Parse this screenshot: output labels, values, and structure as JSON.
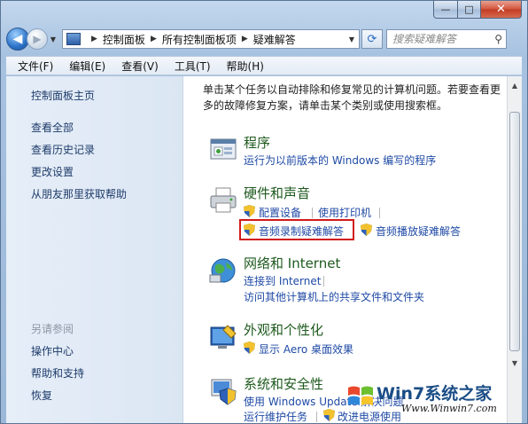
{
  "window": {
    "caption": {
      "minimize": "—",
      "maximize": "□",
      "close": "✕"
    }
  },
  "nav": {
    "back": "◀",
    "forward": "▶",
    "dropdown": "▼",
    "breadcrumbs": [
      "控制面板",
      "所有控制面板项",
      "疑难解答"
    ],
    "search_placeholder": "搜索疑难解答"
  },
  "menu": [
    "文件(F)",
    "编辑(E)",
    "查看(V)",
    "工具(T)",
    "帮助(H)"
  ],
  "left_pane": {
    "links": [
      "控制面板主页",
      "查看全部",
      "查看历史记录",
      "更改设置",
      "从朋友那里获取帮助"
    ],
    "see_also_title": "另请参阅",
    "see_also_links": [
      "操作中心",
      "帮助和支持",
      "恢复"
    ]
  },
  "main": {
    "intro": "单击某个任务以自动排除和修复常见的计算机问题。若要查看更多的故障修复方案，请单击某个类别或使用搜索框。",
    "categories": [
      {
        "title": "程序",
        "links": [
          "运行为以前版本的 Windows 编写的程序"
        ]
      },
      {
        "title": "硬件和声音",
        "links": [
          "配置设备",
          "使用打印机",
          "音频录制疑难解答",
          "音频播放疑难解答"
        ]
      },
      {
        "title": "网络和 Internet",
        "links": [
          "连接到 Internet",
          "访问其他计算机上的共享文件和文件夹"
        ]
      },
      {
        "title": "外观和个性化",
        "links": [
          "显示 Aero 桌面效果"
        ]
      },
      {
        "title": "系统和安全性",
        "links": [
          "使用 Windows Update 解决问题",
          "运行维护任务",
          "改进电源使用"
        ]
      }
    ]
  },
  "watermark": {
    "brand": "Win7系统之家",
    "url": "Www.Winwin7.com"
  },
  "colors": {
    "highlight": "#d11a1a",
    "link": "#1f4aa5",
    "category_title": "#1e5a1e"
  }
}
